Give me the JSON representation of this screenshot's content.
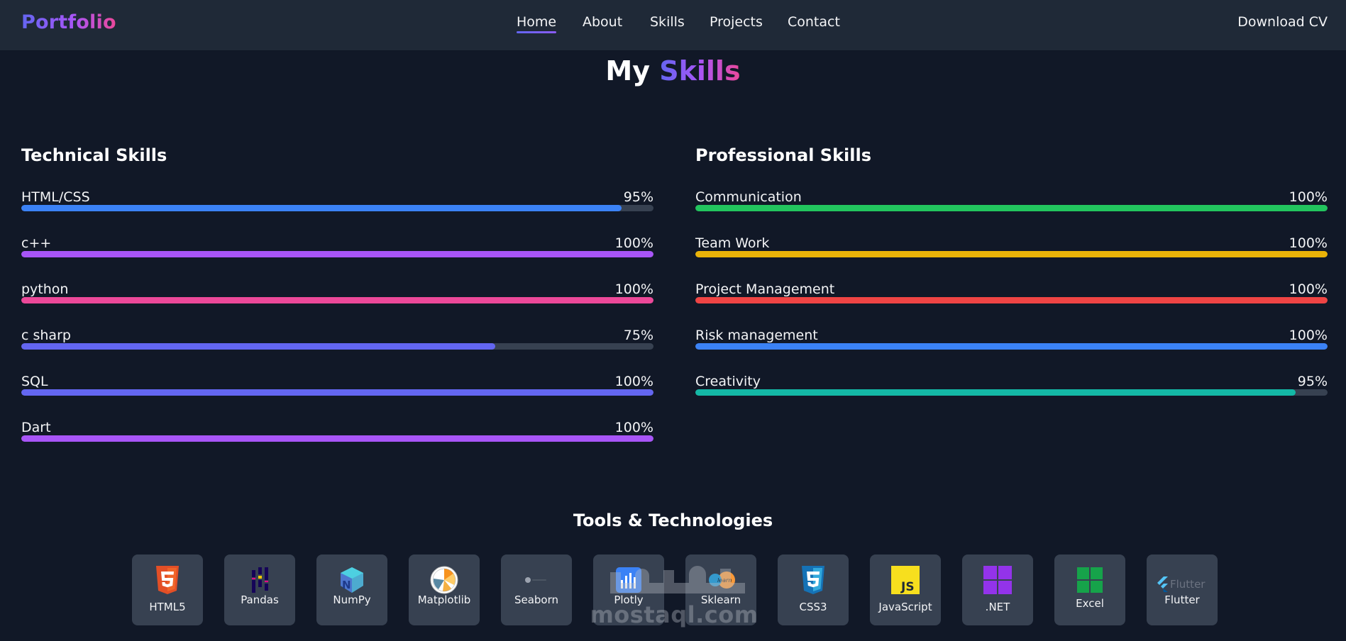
{
  "navbar": {
    "logo": "Portfolio",
    "links": [
      {
        "label": "Home",
        "active": true
      },
      {
        "label": "About",
        "active": false
      },
      {
        "label": "Skills",
        "active": false
      },
      {
        "label": "Projects",
        "active": false
      },
      {
        "label": "Contact",
        "active": false
      }
    ],
    "download_cv": "Download CV"
  },
  "heading": {
    "prefix": "My",
    "accent": "Skills"
  },
  "technical_skills": {
    "title": "Technical Skills",
    "items": [
      {
        "label": "HTML/CSS",
        "percent_text": "95%",
        "percent": 95,
        "color": "#3b82f6"
      },
      {
        "label": "c++",
        "percent_text": "100%",
        "percent": 100,
        "color": "#a855f7"
      },
      {
        "label": "python",
        "percent_text": "100%",
        "percent": 100,
        "color": "#ec4899"
      },
      {
        "label": "c sharp",
        "percent_text": "75%",
        "percent": 75,
        "color": "#6366f1"
      },
      {
        "label": "SQL",
        "percent_text": "100%",
        "percent": 100,
        "color": "#6366f1"
      },
      {
        "label": "Dart",
        "percent_text": "100%",
        "percent": 100,
        "color": "#a855f7"
      }
    ]
  },
  "professional_skills": {
    "title": "Professional Skills",
    "items": [
      {
        "label": "Communication",
        "percent_text": "100%",
        "percent": 100,
        "color": "#22c55e"
      },
      {
        "label": "Team Work",
        "percent_text": "100%",
        "percent": 100,
        "color": "#eab308"
      },
      {
        "label": "Project Management",
        "percent_text": "100%",
        "percent": 100,
        "color": "#ef4444"
      },
      {
        "label": "Risk management",
        "percent_text": "100%",
        "percent": 100,
        "color": "#3b82f6"
      },
      {
        "label": "Creativity",
        "percent_text": "95%",
        "percent": 95,
        "color": "#14b8a6"
      }
    ]
  },
  "tools": {
    "title": "Tools & Technologies",
    "items": [
      {
        "name": "HTML5",
        "icon": "html5-icon"
      },
      {
        "name": "Pandas",
        "icon": "pandas-icon"
      },
      {
        "name": "NumPy",
        "icon": "numpy-icon"
      },
      {
        "name": "Matplotlib",
        "icon": "matplotlib-icon"
      },
      {
        "name": "Seaborn",
        "icon": "seaborn-icon"
      },
      {
        "name": "Plotly",
        "icon": "plotly-icon"
      },
      {
        "name": "Sklearn",
        "icon": "sklearn-icon"
      },
      {
        "name": "CSS3",
        "icon": "css3-icon"
      },
      {
        "name": "JavaScript",
        "icon": "javascript-icon"
      },
      {
        "name": ".NET",
        "icon": "dotnet-icon"
      },
      {
        "name": "Excel",
        "icon": "excel-icon"
      },
      {
        "name": "Flutter",
        "icon": "flutter-icon"
      }
    ]
  },
  "watermark": {
    "arabic": "مستقل",
    "latin": "mostaql.com"
  }
}
